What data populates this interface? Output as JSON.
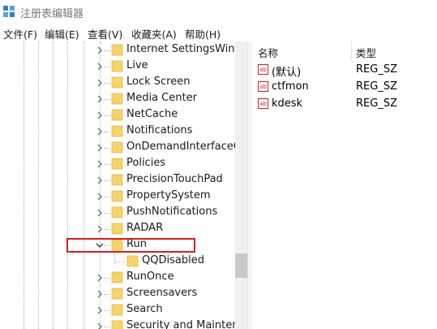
{
  "window": {
    "title": "注册表编辑器"
  },
  "menu": [
    "文件(F)",
    "编辑(E)",
    "查看(V)",
    "收藏夹(A)",
    "帮助(H)"
  ],
  "tree": {
    "items": [
      {
        "label": "Internet SettingsWindo",
        "expandable": true
      },
      {
        "label": "Live",
        "expandable": true
      },
      {
        "label": "Lock Screen",
        "expandable": true
      },
      {
        "label": "Media Center",
        "expandable": true
      },
      {
        "label": "NetCache",
        "expandable": true
      },
      {
        "label": "Notifications",
        "expandable": true
      },
      {
        "label": "OnDemandInterfaceCa",
        "expandable": true
      },
      {
        "label": "Policies",
        "expandable": true
      },
      {
        "label": "PrecisionTouchPad",
        "expandable": true
      },
      {
        "label": "PropertySystem",
        "expandable": true
      },
      {
        "label": "PushNotifications",
        "expandable": true
      },
      {
        "label": "RADAR",
        "expandable": true
      },
      {
        "label": "Run",
        "expandable": true,
        "expanded": true,
        "highlighted": true
      },
      {
        "label": "QQDisabled",
        "expandable": false,
        "child": true
      },
      {
        "label": "RunOnce",
        "expandable": true
      },
      {
        "label": "Screensavers",
        "expandable": true
      },
      {
        "label": "Search",
        "expandable": true
      },
      {
        "label": "Security and Maintenar",
        "expandable": true
      }
    ]
  },
  "list": {
    "columns": {
      "name": "名称",
      "type": "类型"
    },
    "rows": [
      {
        "name": "(默认)",
        "type": "REG_SZ",
        "icon": "string-value-icon"
      },
      {
        "name": "ctfmon",
        "type": "REG_SZ",
        "icon": "string-value-icon"
      },
      {
        "name": "kdesk",
        "type": "REG_SZ",
        "icon": "string-value-icon"
      }
    ]
  },
  "colors": {
    "highlight_border": "#d3201f",
    "folder": "#f6d36b"
  }
}
